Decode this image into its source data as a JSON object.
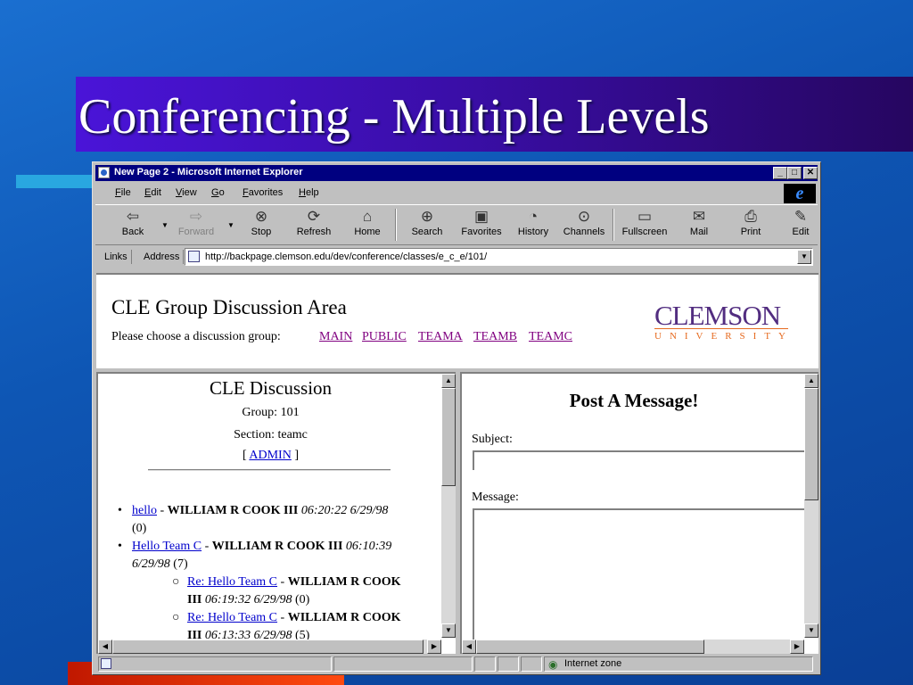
{
  "slide": {
    "title": "Conferencing - Multiple Levels"
  },
  "window": {
    "title": "New Page 2 - Microsoft Internet Explorer",
    "controls": {
      "minimize": "_",
      "maximize": "□",
      "close": "✕"
    }
  },
  "menu": [
    "File",
    "Edit",
    "View",
    "Go",
    "Favorites",
    "Help"
  ],
  "toolbar": {
    "back": "Back",
    "forward": "Forward",
    "stop": "Stop",
    "refresh": "Refresh",
    "home": "Home",
    "search": "Search",
    "favorites": "Favorites",
    "history": "History",
    "channels": "Channels",
    "fullscreen": "Fullscreen",
    "mail": "Mail",
    "print": "Print",
    "edit": "Edit"
  },
  "addressbar": {
    "links_label": "Links",
    "address_label": "Address",
    "url": "http://backpage.clemson.edu/dev/conference/classes/e_c_e/101/"
  },
  "top_frame": {
    "heading": "CLE Group Discussion Area",
    "prompt": "Please choose a discussion group:",
    "groups": [
      "MAIN",
      "PUBLIC",
      "TEAMA",
      "TEAMB",
      "TEAMC"
    ],
    "logo": {
      "name": "CLEMSON",
      "sub": "UNIVERSITY"
    }
  },
  "discussion": {
    "title": "CLE Discussion",
    "group": "Group:   101",
    "section": "Section: teamc",
    "admin_link": "ADMIN",
    "bracket_open": "[",
    "bracket_close": "]",
    "threads": [
      {
        "subject": "hello",
        "author": "WILLIAM R COOK III",
        "time": "06:20:22 6/29/98",
        "count": "(0)"
      },
      {
        "subject": "Hello Team C",
        "author": "WILLIAM R COOK III",
        "time": "06:10:39 6/29/98",
        "count": "(7)"
      }
    ],
    "replies": [
      {
        "subject": "Re: Hello Team C",
        "author": "WILLIAM R COOK III",
        "time": "06:19:32 6/29/98",
        "count": "(0)"
      },
      {
        "subject": "Re: Hello Team C",
        "author": "WILLIAM R COOK III",
        "time": "06:13:33 6/29/98",
        "count": "(5)"
      }
    ]
  },
  "post_form": {
    "title": "Post A Message!",
    "subject_label": "Subject:",
    "message_label": "Message:"
  },
  "status": {
    "zone": "Internet zone"
  },
  "colors": {
    "visited_link": "#800080",
    "link": "#0000cc",
    "clemson_purple": "#522d80",
    "clemson_orange": "#e66a1f"
  }
}
